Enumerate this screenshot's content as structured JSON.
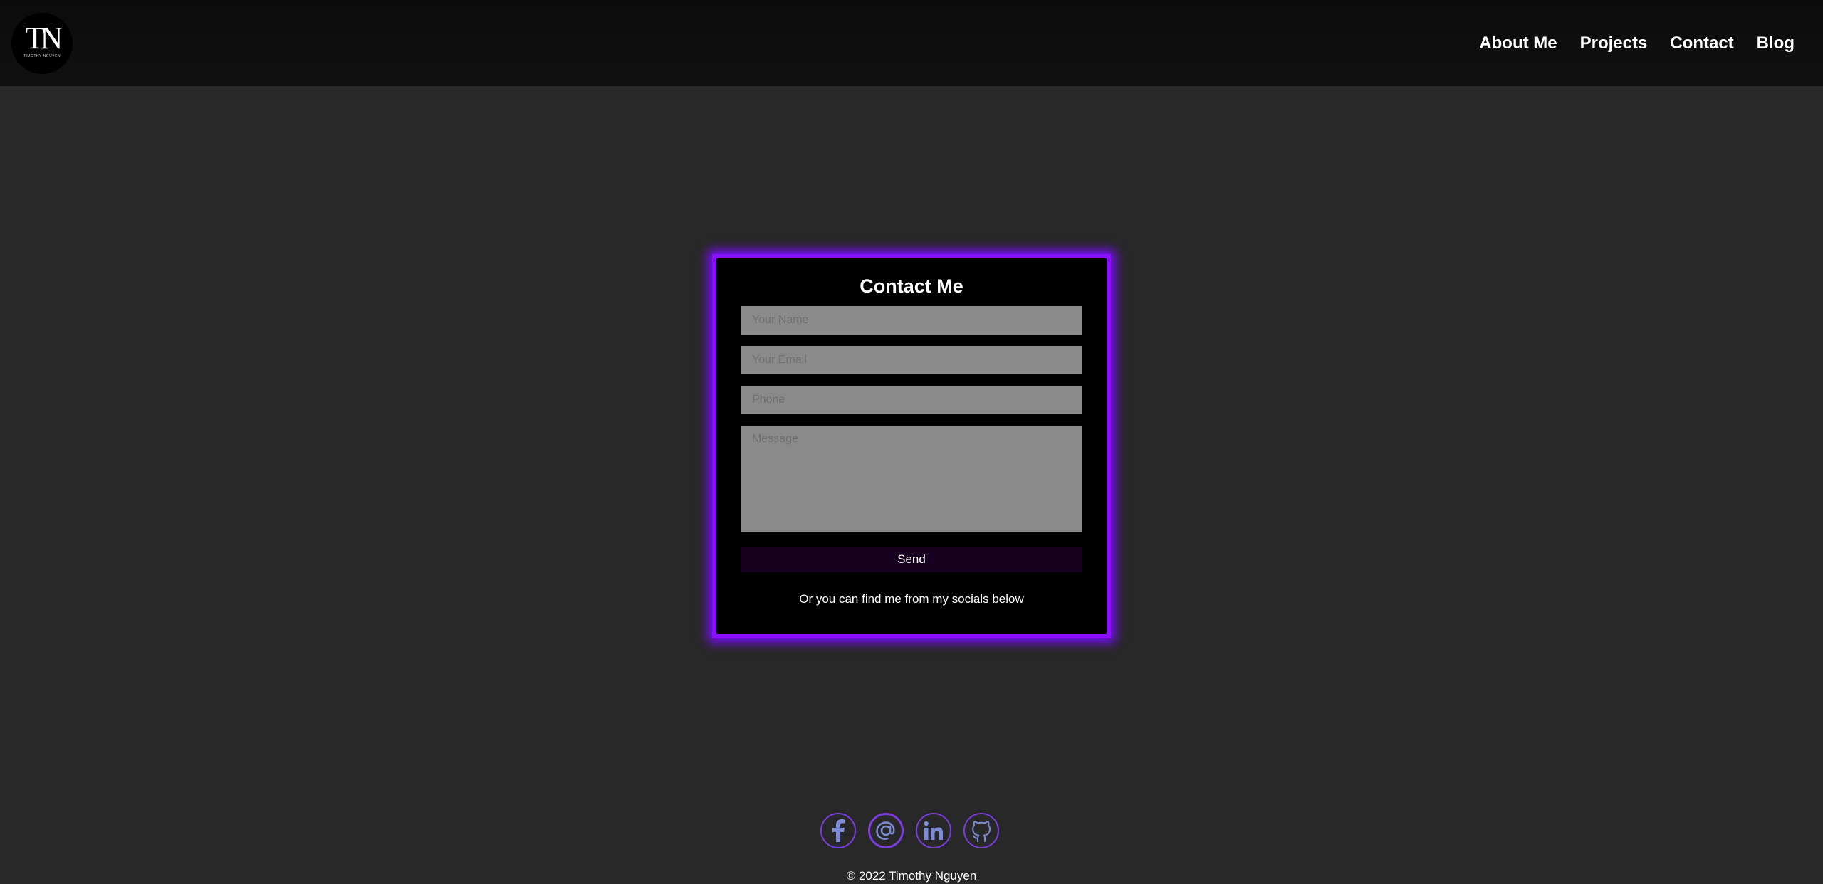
{
  "logo": {
    "mark": "TN",
    "subtitle": "TIMOTHY NGUYEN"
  },
  "nav": {
    "items": [
      "About Me",
      "Projects",
      "Contact",
      "Blog"
    ]
  },
  "contact": {
    "title": "Contact Me",
    "name_placeholder": "Your Name",
    "email_placeholder": "Your Email",
    "phone_placeholder": "Phone",
    "message_placeholder": "Message",
    "send_label": "Send",
    "socials_note": "Or you can find me from my socials below"
  },
  "socials": {
    "icons": [
      "facebook-icon",
      "email-at-icon",
      "linkedin-icon",
      "github-icon"
    ]
  },
  "footer": {
    "copyright": "© 2022 Timothy Nguyen"
  },
  "colors": {
    "accent": "#8b0fff",
    "background": "#282828",
    "card": "#000000",
    "field": "#8a8a8a",
    "icon": "#7e8cd8"
  }
}
